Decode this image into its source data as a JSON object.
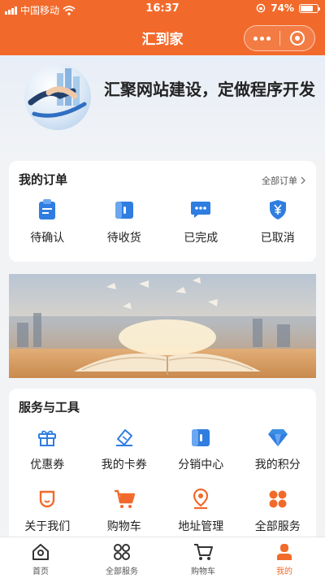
{
  "status_bar": {
    "carrier": "中国移动",
    "time": "16:37",
    "battery": "74%",
    "battery_level": 0.74
  },
  "header": {
    "title": "汇到家"
  },
  "hero": {
    "text": "汇聚网站建设，定做程序开发"
  },
  "orders": {
    "title": "我的订单",
    "more": "全部订单",
    "items": [
      {
        "label": "待确认",
        "icon": "clipboard-icon"
      },
      {
        "label": "待收货",
        "icon": "package-icon"
      },
      {
        "label": "已完成",
        "icon": "chat-dots-icon"
      },
      {
        "label": "已取消",
        "icon": "yen-shield-icon"
      }
    ]
  },
  "services": {
    "title": "服务与工具",
    "items": [
      {
        "label": "优惠券",
        "icon": "gift-icon"
      },
      {
        "label": "我的卡券",
        "icon": "ticket-icon"
      },
      {
        "label": "分销中心",
        "icon": "distribution-icon"
      },
      {
        "label": "我的积分",
        "icon": "diamond-icon"
      },
      {
        "label": "关于我们",
        "icon": "about-icon"
      },
      {
        "label": "购物车",
        "icon": "cart-icon"
      },
      {
        "label": "地址管理",
        "icon": "location-pin-icon"
      },
      {
        "label": "全部服务",
        "icon": "grid-icon"
      }
    ]
  },
  "tabbar": {
    "items": [
      {
        "label": "首页",
        "icon": "home-icon"
      },
      {
        "label": "全部服务",
        "icon": "grid-outline-icon"
      },
      {
        "label": "购物车",
        "icon": "cart-outline-icon"
      },
      {
        "label": "我的",
        "icon": "user-icon"
      }
    ],
    "active_index": 3
  },
  "colors": {
    "brand": "#f26a2b",
    "icon_blue": "#2f7de1"
  }
}
